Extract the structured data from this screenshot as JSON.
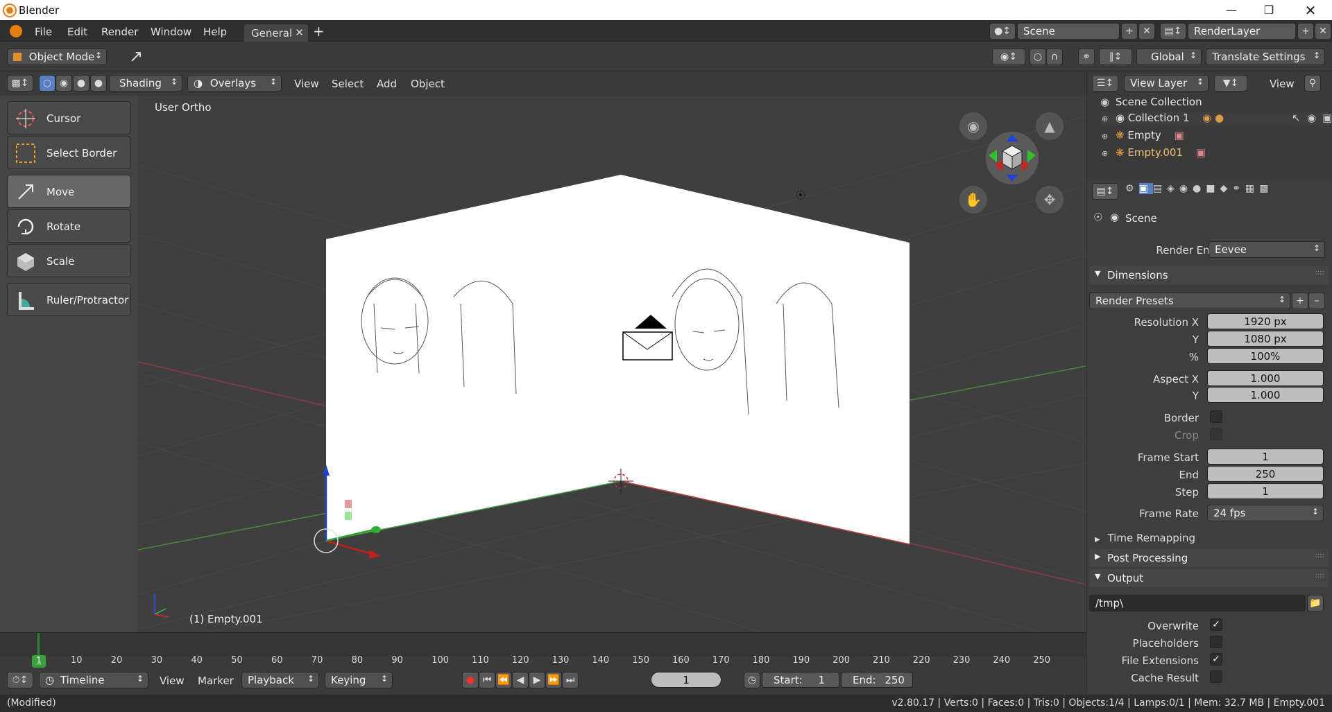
{
  "window": {
    "title": "Blender"
  },
  "menu": {
    "file": "File",
    "edit": "Edit",
    "render": "Render",
    "window": "Window",
    "help": "Help"
  },
  "workspace": {
    "tab": "General"
  },
  "scene_selector": {
    "value": "Scene"
  },
  "renderlayer_selector": {
    "value": "RenderLayer"
  },
  "header": {
    "mode": "Object Mode",
    "orientation": "Global",
    "translate_settings": "Translate Settings"
  },
  "viewport_header": {
    "shading": "Shading",
    "overlays": "Overlays",
    "view": "View",
    "select": "Select",
    "add": "Add",
    "object": "Object"
  },
  "tools": [
    {
      "label": "Cursor"
    },
    {
      "label": "Select Border"
    },
    {
      "label": "Move"
    },
    {
      "label": "Rotate"
    },
    {
      "label": "Scale"
    },
    {
      "label": "Ruler/Protractor"
    }
  ],
  "viewport": {
    "view_name": "User Ortho",
    "active_object": "(1) Empty.001"
  },
  "outliner": {
    "view_layer": "View Layer",
    "view": "View",
    "items": [
      {
        "label": "Scene Collection"
      },
      {
        "label": "Collection 1"
      },
      {
        "label": "Empty"
      },
      {
        "label": "Empty.001"
      }
    ]
  },
  "properties": {
    "context": "Scene",
    "render_engine_label": "Render Engine",
    "render_engine": "Eevee",
    "dimensions": "Dimensions",
    "render_presets": "Render Presets",
    "resolution_x_label": "Resolution X",
    "resolution_x": "1920 px",
    "y_label": "Y",
    "resolution_y": "1080 px",
    "pct_label": "%",
    "resolution_pct": "100%",
    "aspect_x_label": "Aspect X",
    "aspect_x": "1.000",
    "aspect_y_label": "Y",
    "aspect_y": "1.000",
    "border_label": "Border",
    "crop_label": "Crop",
    "frame_start_label": "Frame Start",
    "frame_start": "1",
    "end_label": "End",
    "frame_end": "250",
    "step_label": "Step",
    "frame_step": "1",
    "frame_rate_label": "Frame Rate",
    "frame_rate": "24 fps",
    "time_remapping": "Time Remapping",
    "post_processing": "Post Processing",
    "output": "Output",
    "output_path": "/tmp\\",
    "overwrite_label": "Overwrite",
    "placeholders_label": "Placeholders",
    "file_extensions_label": "File Extensions",
    "cache_result_label": "Cache Result",
    "overwrite": true,
    "placeholders": false,
    "file_extensions": true,
    "cache_result": false
  },
  "timeline": {
    "editor": "Timeline",
    "view": "View",
    "marker": "Marker",
    "playback": "Playback",
    "keying": "Keying",
    "current_frame": "1",
    "start_label": "Start:",
    "start": "1",
    "end_label": "End:",
    "end": "250",
    "ruler_current": "1",
    "ruler_ticks": [
      "10",
      "20",
      "30",
      "40",
      "50",
      "60",
      "70",
      "80",
      "90",
      "100",
      "110",
      "120",
      "130",
      "140",
      "150",
      "160",
      "170",
      "180",
      "190",
      "200",
      "210",
      "220",
      "230",
      "240",
      "250"
    ]
  },
  "status": {
    "left": "(Modified)",
    "right": "v2.80.17 | Verts:0 | Faces:0 | Tris:0 | Objects:1/4 | Lamps:0/1 | Mem: 32.7 MB | Empty.001"
  },
  "colors": {
    "accent": "#5680c2",
    "x_axis": "#c03030",
    "y_axis": "#3fa03f",
    "z_axis": "#2040d0",
    "frame_marker": "#2a8a2a"
  }
}
